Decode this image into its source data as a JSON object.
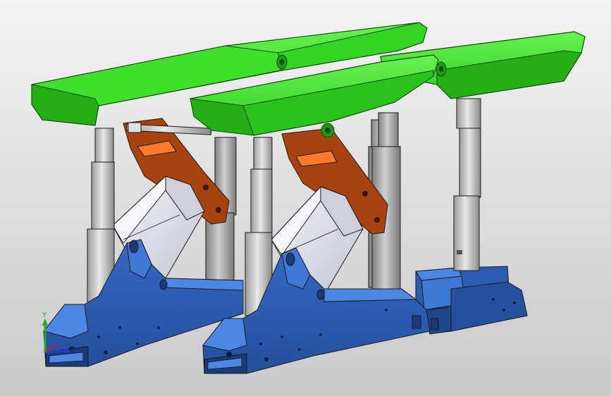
{
  "viewport": {
    "background_top": "#f3f3f3",
    "background_bottom": "#c9c9c9"
  },
  "colors": {
    "canopy": "#2fcf1f",
    "canopy_light": "#5ff04a",
    "canopy_dark": "#1c9a12",
    "canopy_edge": "#0e4a08",
    "lemniscate": "#a8420f",
    "lemniscate_light": "#ff7a2a",
    "shield": "#e9e9f2",
    "shield_shade": "#b9b9c6",
    "leg": "#d2d2d2",
    "leg_dark": "#8f8f8f",
    "base": "#2c5db3",
    "base_light": "#4d87e6",
    "base_dark": "#1a3a78",
    "line": "#1a1a1a"
  },
  "triad": {
    "y_label": "Y",
    "z_label": "Z",
    "y_color": "#1faa1f",
    "z_color": "#1f3fd0",
    "x_color": "#d01f1f"
  },
  "icons": [
    "coordinate-triad-icon"
  ]
}
